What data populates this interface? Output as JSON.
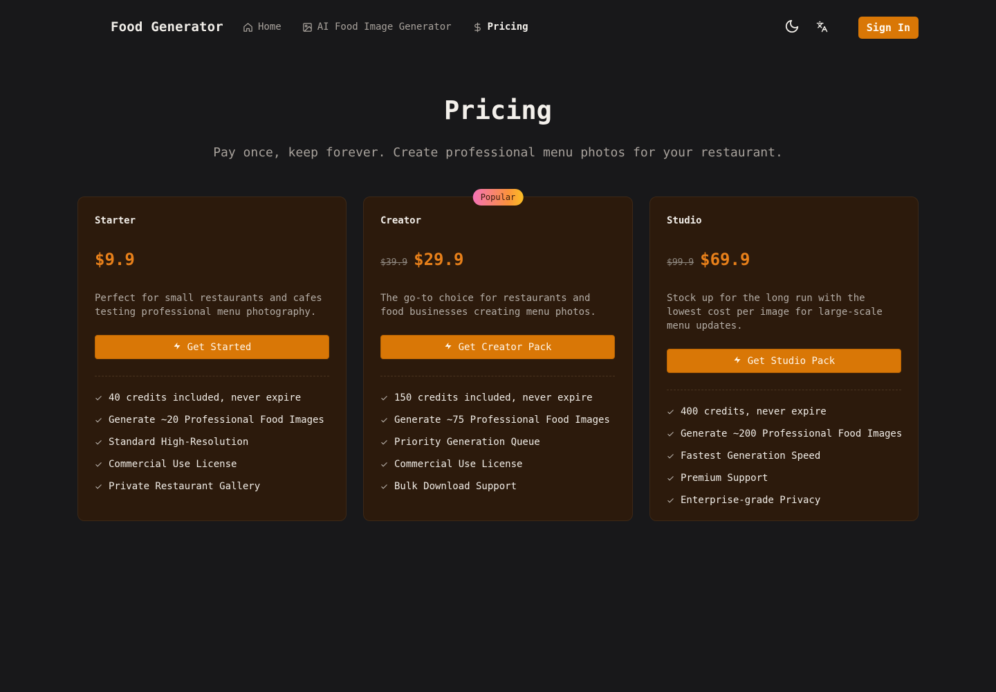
{
  "header": {
    "brand": "Food Generator",
    "nav": [
      {
        "label": "Home",
        "icon": "home-icon"
      },
      {
        "label": "AI Food Image Generator",
        "icon": "image-icon"
      },
      {
        "label": "Pricing",
        "icon": "dollar-icon",
        "active": true
      }
    ],
    "theme_icon": "moon-icon",
    "language_icon": "translate-icon",
    "sign_in": "Sign In"
  },
  "hero": {
    "title": "Pricing",
    "subtitle": "Pay once, keep forever. Create professional menu photos for your restaurant."
  },
  "plans": [
    {
      "name": "Starter",
      "old_price": "",
      "price": "$9.9",
      "description": "Perfect for small restaurants and cafes testing professional menu photography.",
      "cta": "Get Started",
      "features": [
        "40 credits included, never expire",
        "Generate ~20 Professional Food Images",
        "Standard High-Resolution",
        "Commercial Use License",
        "Private Restaurant Gallery"
      ]
    },
    {
      "name": "Creator",
      "badge": "Popular",
      "old_price": "$39.9",
      "price": "$29.9",
      "description": "The go-to choice for restaurants and food businesses creating menu photos.",
      "cta": "Get Creator Pack",
      "features": [
        "150 credits included, never expire",
        "Generate ~75 Professional Food Images",
        "Priority Generation Queue",
        "Commercial Use License",
        "Bulk Download Support"
      ]
    },
    {
      "name": "Studio",
      "old_price": "$99.9",
      "price": "$69.9",
      "description": "Stock up for the long run with the lowest cost per image for large-scale menu updates.",
      "cta": "Get Studio Pack",
      "features": [
        "400 credits, never expire",
        "Generate ~200 Professional Food Images",
        "Fastest Generation Speed",
        "Premium Support",
        "Enterprise-grade Privacy"
      ]
    }
  ],
  "colors": {
    "background": "#18181a",
    "card": "#2c1a0c",
    "accent": "#d97706",
    "price": "#e8801a"
  }
}
